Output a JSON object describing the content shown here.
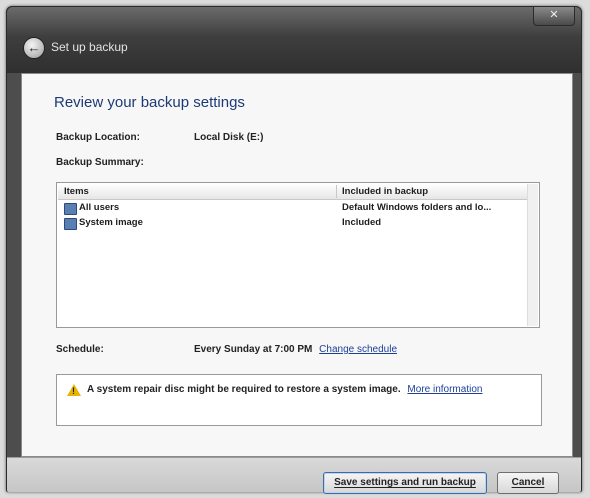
{
  "window": {
    "title": "Set up backup",
    "close_glyph": "✕",
    "back_glyph": "←"
  },
  "page": {
    "heading": "Review your backup settings"
  },
  "backup": {
    "location_label": "Backup Location:",
    "location_value": "Local Disk (E:)",
    "summary_label": "Backup Summary:"
  },
  "table": {
    "columns": [
      "Items",
      "Included in backup"
    ],
    "rows": [
      {
        "icon": "users-icon",
        "item": "All users",
        "included": "Default Windows folders and lo..."
      },
      {
        "icon": "system-image-icon",
        "item": "System image",
        "included": "Included"
      }
    ]
  },
  "schedule": {
    "label": "Schedule:",
    "value": "Every Sunday at 7:00 PM",
    "change_link": "Change schedule"
  },
  "notice": {
    "icon": "warning-icon",
    "text": "A system repair disc might be required to restore a system image.",
    "link": "More information"
  },
  "buttons": {
    "save": "Save settings and run backup",
    "cancel": "Cancel"
  },
  "colors": {
    "heading": "#1d3b73",
    "link": "#1d3f9a",
    "warning": "#e6b400"
  }
}
